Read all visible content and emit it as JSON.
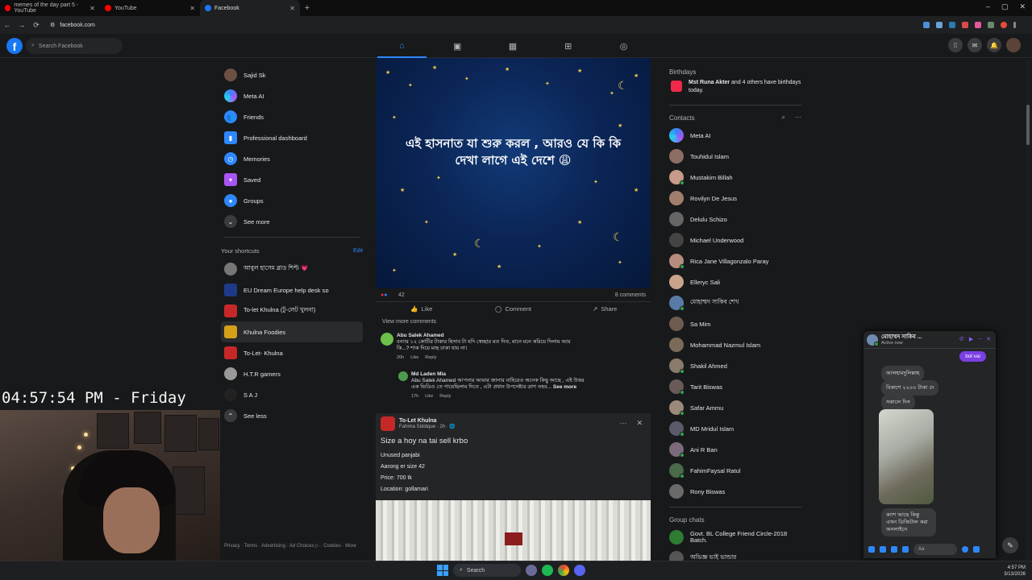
{
  "browser": {
    "tabs": [
      {
        "title": "memes of the day part 5 - YouTube",
        "color": "#ff0000"
      },
      {
        "title": "YouTube",
        "color": "#ff0000"
      },
      {
        "title": "Facebook",
        "color": "#1877f2"
      }
    ],
    "url": "facebook.com"
  },
  "fb": {
    "logo": "f",
    "search_placeholder": "Search Facebook",
    "nav": [
      "home-icon",
      "video-icon",
      "calendar-icon",
      "marketplace-icon",
      "groups-icon"
    ]
  },
  "left": {
    "items": [
      {
        "label": "Sajid Sk",
        "icon": "avatar",
        "color": "#6b5043"
      },
      {
        "label": "Meta AI",
        "icon": "meta-ai-icon",
        "color": "#3b4fdc"
      },
      {
        "label": "Friends",
        "icon": "friends-icon",
        "color": "#2d88ff"
      },
      {
        "label": "Professional dashboard",
        "icon": "dashboard-icon",
        "color": "#2d88ff"
      },
      {
        "label": "Memories",
        "icon": "memories-icon",
        "color": "#2d88ff"
      },
      {
        "label": "Saved",
        "icon": "saved-icon",
        "color": "#a855f7"
      },
      {
        "label": "Groups",
        "icon": "groups-icon",
        "color": "#2d88ff"
      },
      {
        "label": "See more",
        "icon": "chevron-down-icon",
        "color": "#3a3b3c"
      }
    ],
    "shortcuts_title": "Your shortcuts",
    "edit": "Edit",
    "shortcuts": [
      {
        "label": "আবুল হাসেম ব্লাড শিপ্ট 💗",
        "color": "#777777"
      },
      {
        "label": "EU Dream Europe help desk ꜱᴅ",
        "color": "#1e3a8a"
      },
      {
        "label": "To-let Khulna (টু-লেট খুলনা)",
        "color": "#c62828"
      },
      {
        "label": "Khulna Foodies",
        "color": "#d4a017"
      },
      {
        "label": "To-Let- Khulna",
        "color": "#c62828"
      },
      {
        "label": "H.T.R gamers",
        "color": "#999999"
      },
      {
        "label": "S A J",
        "color": "#222222"
      },
      {
        "label": "See less",
        "color": "#3a3b3c"
      }
    ],
    "footer": "Privacy · Terms · Advertising · Ad Choices ▷ · Cookies · More"
  },
  "post1": {
    "text_line1": "এই হাসনাত যা শুরু করল , আরও যে কি কি",
    "text_line2": "দেখা লাগে এই দেশে 😩",
    "reactions": "42",
    "comments_count": "8 comments",
    "like": "Like",
    "comment": "Comment",
    "share": "Share",
    "view_more": "View more comments",
    "comments": [
      {
        "name": "Abu Salek Ahamed",
        "text1": "বন্যার ১২ কোটির টাকার হিসাব টা যদি স্বেচ্ছার মত দিত, মানে মনে করিয়ে দিলাম আর",
        "text2": "কি...? শাক দিয়ে মাছ ঢাকা যায় না।",
        "time": "20h",
        "like": "Like",
        "reply": "Reply"
      },
      {
        "name": "Md Laden Mia",
        "text1": "Abu Salek Ahamed আপনার আমার জানার বাহিরেও অনেক কিছু আছে , এই উত্তর",
        "text2": "এক ভিডিও তে পায়েছিলাম দিতে , এটা প্রধান উপদেষ্টার ত্রাণ তহব...",
        "see_more": "See more",
        "time": "17h",
        "like": "Like",
        "reply": "Reply"
      }
    ]
  },
  "post2": {
    "page": "To-Let Khulna",
    "author": "Fahima Siddique · 2h · 🌐",
    "title": "Size a hoy na tai sell krbo",
    "lines": [
      "Unused panjabi",
      "Aarong er size 42",
      "Price: 700 tk",
      "Location: gollamari"
    ]
  },
  "right": {
    "birthdays_title": "Birthdays",
    "birthday_name": "Mst Runa Akter",
    "birthday_rest": " and 4 others have birthdays today.",
    "contacts_title": "Contacts",
    "contacts": [
      {
        "name": "Meta AI",
        "color": "#3b4fdc",
        "online": false
      },
      {
        "name": "Touhidul Islam",
        "color": "#8d6e63",
        "online": false
      },
      {
        "name": "Mustakim Billah",
        "color": "#c79a8a",
        "online": true
      },
      {
        "name": "Rovilyn De Jesus",
        "color": "#a07e6e",
        "online": false
      },
      {
        "name": "Delulu Schizo",
        "color": "#666666",
        "online": false
      },
      {
        "name": "Michael Underwood",
        "color": "#444444",
        "online": false
      },
      {
        "name": "Rica Jane Villagonzalo Paray",
        "color": "#b58d7d",
        "online": true
      },
      {
        "name": "Elleryc Sali",
        "color": "#caa38c",
        "online": false
      },
      {
        "name": "মোহাম্মদ সাকিব শেখ",
        "color": "#5a7ba8",
        "online": true
      },
      {
        "name": "Sa Mim",
        "color": "#6e5a4e",
        "online": false
      },
      {
        "name": "Mohammad Nazmul Islam",
        "color": "#7a6a5a",
        "online": false
      },
      {
        "name": "Shakil Ahmed",
        "color": "#8a7a6a",
        "online": true
      },
      {
        "name": "Tarit Biswas",
        "color": "#6a5a5a",
        "online": true
      },
      {
        "name": "Safar Ammu",
        "color": "#9a8a7a",
        "online": true
      },
      {
        "name": "MD Mridul Islam",
        "color": "#5a5a6a",
        "online": true
      },
      {
        "name": "Ani R Ban",
        "color": "#7a6a7a",
        "online": true
      },
      {
        "name": "FahimFaysal Ratul",
        "color": "#4a6a4a",
        "online": true
      },
      {
        "name": "Rony Biswas",
        "color": "#6a6a6a",
        "online": false
      }
    ],
    "groups_title": "Group chats",
    "groups": [
      {
        "name": "Govt. BL College Friend Circle-2018 Batch.",
        "color": "#2e7d32"
      },
      {
        "name": "অভিজ্ঞ ভাই ভান্ডার",
        "color": "#555555"
      }
    ]
  },
  "overlay": {
    "clock": "04:57:54 PM - Friday"
  },
  "chat": {
    "name": "মোহাম্মদ সাকিব ...",
    "status": "Active now",
    "my_msg": "bol vai",
    "msg1": "আলহামদুলিল্লাহ",
    "msg2": "বিকাশে ২২০০ টাকা দে",
    "msg3": "সকালে দিস",
    "msg4": "ক্যাশ আছে কিন্তু এখন ডিজিটাল করা অনলাইনে",
    "input_placeholder": "Aa"
  },
  "taskbar": {
    "search": "Search",
    "time": "4:57 PM",
    "date": "3/13/2026"
  }
}
